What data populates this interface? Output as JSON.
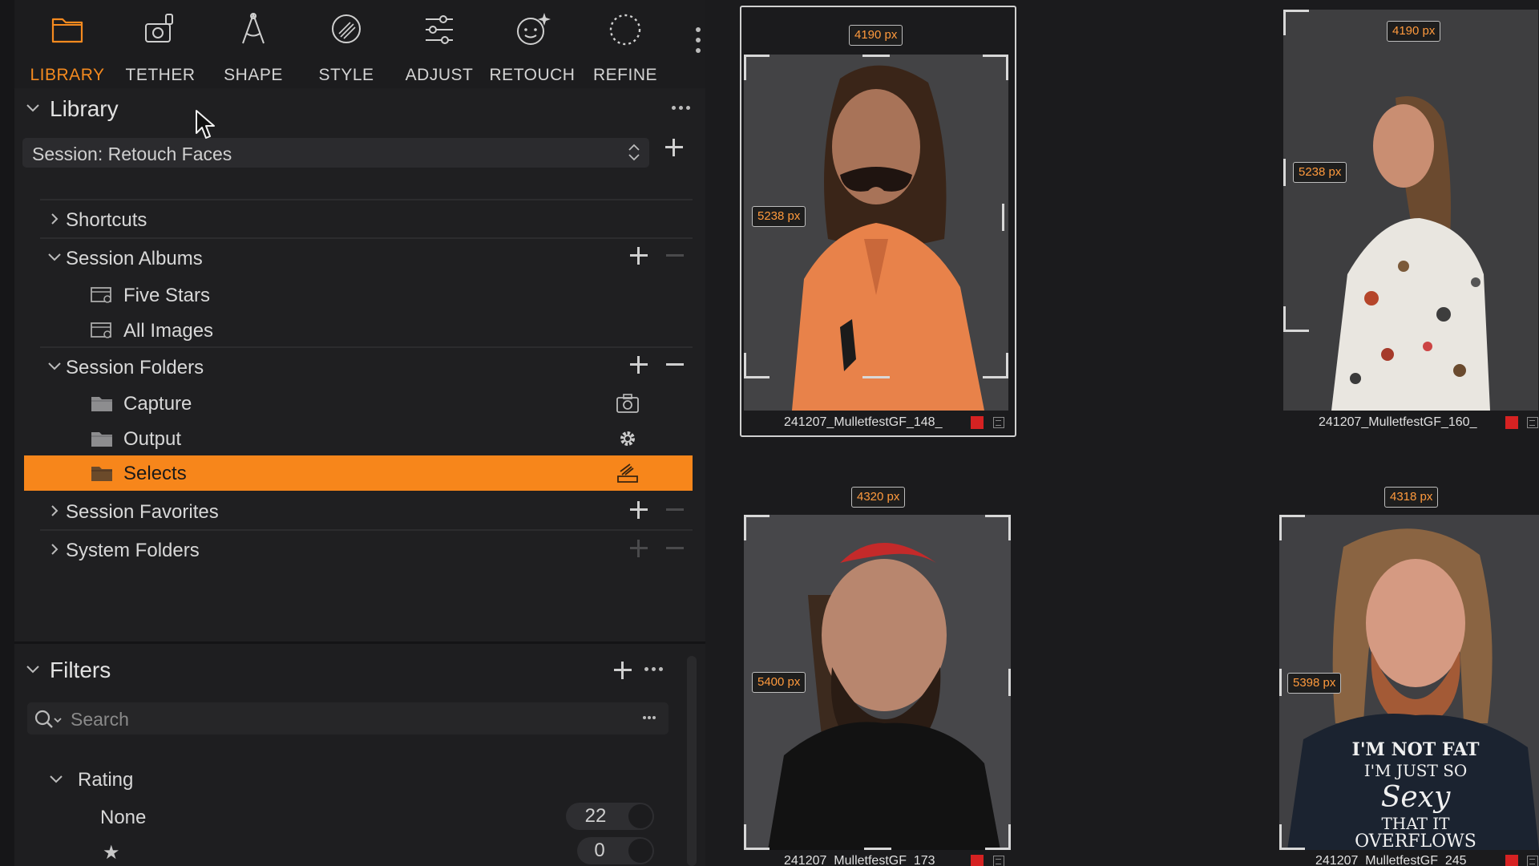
{
  "toolbar": {
    "tabs": [
      {
        "label": "LIBRARY",
        "icon": "folder-icon",
        "active": true
      },
      {
        "label": "TETHER",
        "icon": "camera-tether-icon",
        "active": false
      },
      {
        "label": "SHAPE",
        "icon": "compass-shape-icon",
        "active": false
      },
      {
        "label": "STYLE",
        "icon": "style-brush-icon",
        "active": false
      },
      {
        "label": "ADJUST",
        "icon": "sliders-icon",
        "active": false
      },
      {
        "label": "RETOUCH",
        "icon": "retouch-face-icon",
        "active": false
      },
      {
        "label": "REFINE",
        "icon": "refine-circle-icon",
        "active": false
      }
    ],
    "accent_color": "#f58a1f"
  },
  "library": {
    "title": "Library",
    "session_value": "Session: Retouch Faces",
    "groups": {
      "shortcuts": "Shortcuts",
      "session_albums": "Session Albums",
      "session_folders": "Session Folders",
      "session_favorites": "Session Favorites",
      "system_folders": "System Folders"
    },
    "albums": [
      "Five Stars",
      "All Images"
    ],
    "folders": [
      {
        "label": "Capture",
        "right_icon": "camera-icon"
      },
      {
        "label": "Output",
        "right_icon": "gear-icon"
      },
      {
        "label": "Selects",
        "right_icon": "selects-tray-icon",
        "selected": true
      }
    ],
    "selected_color": "#f7861b"
  },
  "filters": {
    "title": "Filters",
    "search_placeholder": "Search",
    "rating_title": "Rating",
    "ratings": [
      {
        "label": "None",
        "count": "22"
      },
      {
        "label": "★",
        "count": "0"
      }
    ]
  },
  "browser": {
    "thumbnails": [
      {
        "filename": "241207_MulletfestGF_148_",
        "width_tag": "4190 px",
        "height_tag": "5238 px",
        "selected": true
      },
      {
        "filename": "241207_MulletfestGF_160_",
        "width_tag": "4190 px",
        "height_tag": "5238 px",
        "selected": false
      },
      {
        "filename": "241207_MulletfestGF_173",
        "width_tag": "4320 px",
        "height_tag": "5400 px",
        "selected": false
      },
      {
        "filename": "241207_MulletfestGF_245",
        "width_tag": "4318 px",
        "height_tag": "5398 px",
        "selected": false
      }
    ],
    "shirt_text": [
      "I'M NOT FAT",
      "I'M JUST SO",
      "Sexy",
      "THAT IT",
      "OVERFLOWS"
    ]
  }
}
